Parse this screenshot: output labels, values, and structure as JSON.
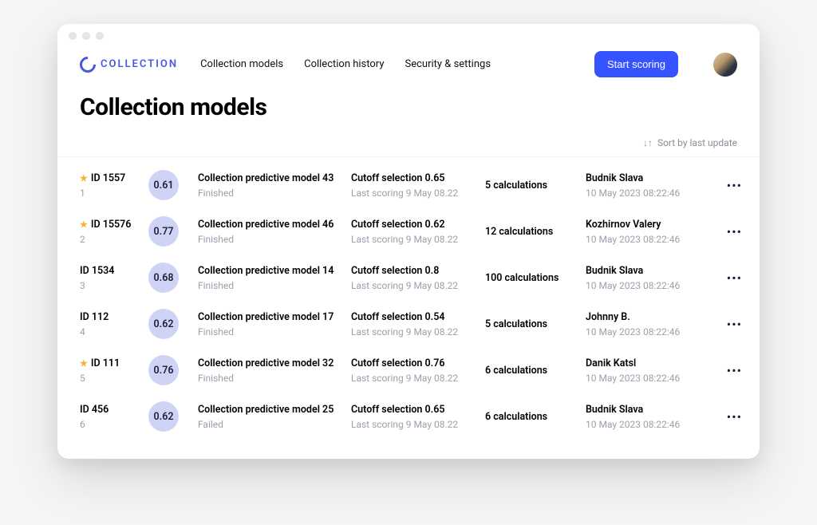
{
  "logo": {
    "text": "COLLECTION"
  },
  "nav": {
    "items": [
      "Collection models",
      "Collection history",
      "Security & settings"
    ],
    "cta": "Start scoring"
  },
  "page_title": "Collection models",
  "sort": {
    "label": "Sort by last update"
  },
  "rows": [
    {
      "starred": true,
      "id": "ID 1557",
      "index": "1",
      "score": "0.61",
      "model": "Collection predictive model 43",
      "status": "Finished",
      "cutoff": "Cutoff selection 0.65",
      "last": "Last scoring 9 May 08.22",
      "calcs": "5 calculations",
      "owner": "Budnik Slava",
      "ts": "10 May 2023 08:22:46"
    },
    {
      "starred": true,
      "id": "ID 15576",
      "index": "2",
      "score": "0.77",
      "model": "Collection predictive model 46",
      "status": "Finished",
      "cutoff": "Cutoff selection 0.62",
      "last": "Last scoring 9 May 08.22",
      "calcs": "12 calculations",
      "owner": "Kozhirnov Valery",
      "ts": "10 May 2023 08:22:46"
    },
    {
      "starred": false,
      "id": "ID 1534",
      "index": "3",
      "score": "0.68",
      "model": "Collection predictive model 14",
      "status": "Finished",
      "cutoff": "Cutoff selection 0.8",
      "last": "Last scoring 9 May 08.22",
      "calcs": "100 calculations",
      "owner": "Budnik Slava",
      "ts": "10 May 2023 08:22:46"
    },
    {
      "starred": false,
      "id": "ID 112",
      "index": "4",
      "score": "0.62",
      "model": "Collection predictive model 17",
      "status": "Finished",
      "cutoff": "Cutoff selection 0.54",
      "last": "Last scoring 9 May 08.22",
      "calcs": "5 calculations",
      "owner": "Johnny B.",
      "ts": "10 May 2023 08:22:46"
    },
    {
      "starred": true,
      "id": "ID 111",
      "index": "5",
      "score": "0.76",
      "model": "Collection predictive model 32",
      "status": "Finished",
      "cutoff": "Cutoff selection 0.76",
      "last": "Last scoring 9 May 08.22",
      "calcs": "6 calculations",
      "owner": "Danik Katsl",
      "ts": "10 May 2023 08:22:46"
    },
    {
      "starred": false,
      "id": "ID 456",
      "index": "6",
      "score": "0.62",
      "model": "Collection predictive model 25",
      "status": "Failed",
      "cutoff": "Cutoff selection 0.65",
      "last": "Last scoring 9 May 08.22",
      "calcs": "6 calculations",
      "owner": "Budnik Slava",
      "ts": "10 May 2023 08:22:46"
    }
  ]
}
